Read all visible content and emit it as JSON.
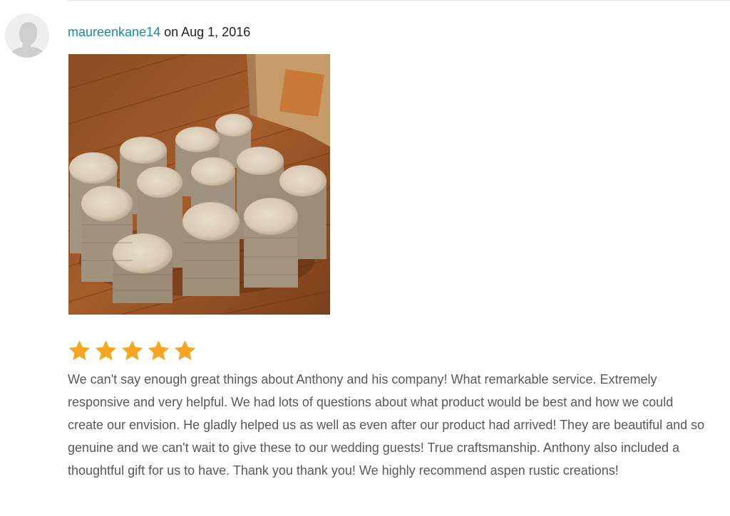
{
  "review": {
    "username": "maureenkane14",
    "date_text": " on Aug 1, 2016",
    "rating": 5,
    "rating_max": 5,
    "text": "We can't say enough great things about Anthony and his company! What remarkable service. Extremely responsive and very helpful. We had lots of questions about what product would be best and how we could create our envision. He gladly helped us as well as even after our product had arrived! They are beautiful and so genuine and we can't wait to give these to our wedding guests! True craftsmanship. Anthony also included a thoughtful gift for us to have. Thank you thank you! We highly recommend aspen rustic creations!",
    "photo_icon": "review-photo",
    "avatar_icon": "default-user-avatar"
  },
  "colors": {
    "username_link": "#168ea2",
    "star": "#f5a623",
    "body_text": "#595959",
    "divider": "#e1e3df"
  }
}
